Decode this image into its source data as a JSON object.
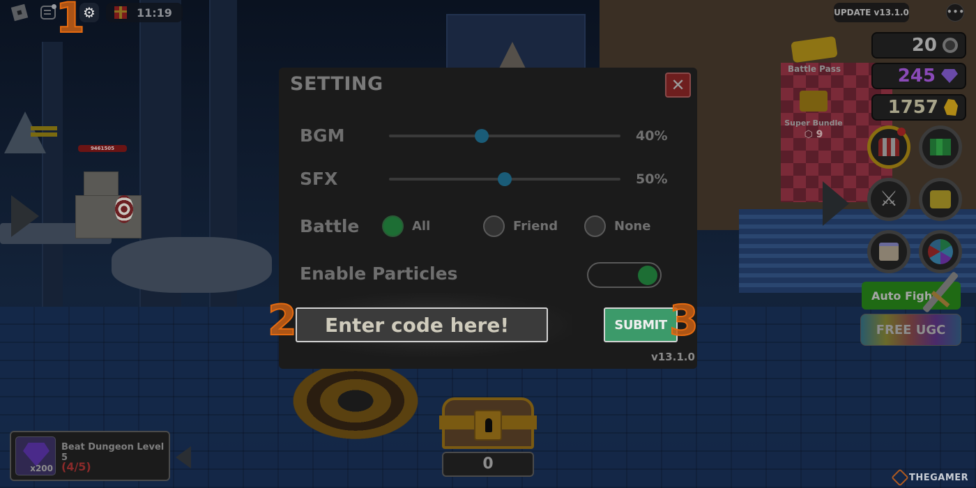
{
  "hud_top_left": {
    "timer": "11:19",
    "icons": [
      "roblox-logo-icon",
      "chat-icon",
      "gear-icon",
      "gift-icon"
    ]
  },
  "hud_top_right": {
    "update_badge": "UPDATE v13.1.0",
    "more_label": "•••",
    "currencies": [
      {
        "name": "coins",
        "value": "20",
        "icon": "coin-icon",
        "color": "#a0a0a0"
      },
      {
        "name": "gems",
        "value": "245",
        "icon": "gem-icon",
        "color": "#8a4ab8"
      },
      {
        "name": "gold",
        "value": "1757",
        "icon": "gold-icon",
        "color": "#a8a48a"
      }
    ],
    "battle_pass_label": "Battle Pass",
    "super_bundle_label": "Super Bundle",
    "super_bundle_price": "⬡ 9",
    "auto_fight_label": "Auto Fight",
    "free_ugc_label": "FREE UGC"
  },
  "scene": {
    "enemy_hp": "9461505"
  },
  "annotations": [
    "1",
    "2",
    "3"
  ],
  "settings": {
    "title": "SETTING",
    "close_label": "✕",
    "bgm": {
      "label": "BGM",
      "value_pct": 40,
      "value_text": "40%"
    },
    "sfx": {
      "label": "SFX",
      "value_pct": 50,
      "value_text": "50%"
    },
    "battle": {
      "label": "Battle",
      "options": [
        "All",
        "Friend",
        "None"
      ],
      "selected": "All"
    },
    "particles": {
      "label": "Enable Particles",
      "enabled": true
    },
    "code_input": {
      "placeholder": "Enter code here!",
      "value": ""
    },
    "submit_label": "SUBMIT",
    "version": "v13.1.0"
  },
  "quest": {
    "reward_count": "x200",
    "title": "Beat Dungeon Level 5",
    "progress": "(4/5)"
  },
  "chest": {
    "count": "0"
  },
  "watermark": "THEGAMER"
}
